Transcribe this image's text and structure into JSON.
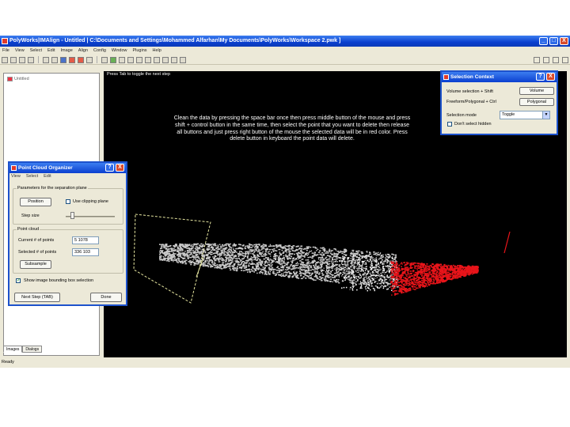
{
  "window": {
    "title": "PolyWorks|IMAlign - Untitled | C:\\Documents and Settings\\Mohammed Alfarhan\\My Documents\\PolyWorks\\Workspace 2.pwk ]",
    "minimize": "_",
    "maximize": "□",
    "close": "X"
  },
  "menu": [
    "File",
    "View",
    "Select",
    "Edit",
    "Image",
    "Align",
    "Config",
    "Window",
    "Plugins",
    "Help"
  ],
  "tree": {
    "item": "Untitled"
  },
  "tabs": [
    "Images",
    "Dialogs"
  ],
  "viewport": {
    "label": "Press Tab to toggle the next step",
    "instructions": "Clean the data by pressing the space bar once then press middle button of the mouse and press shift + control button in the same time, then select the point that you want to delete then release all buttons and just press right button of the mouse the selected data will be in red color. Press delete button in keyboard the point data will delete."
  },
  "status": "Ready",
  "selection_context": {
    "title": "Selection Context",
    "volume_label": "Volume selection + Shift",
    "volume_button": "Volume",
    "freeform_label": "Freeform/Polygonal + Ctrl",
    "freeform_button": "Polygonal",
    "mode_label": "Selection mode",
    "mode_value": "Toggle",
    "dont_select_label": "Don't select hidden"
  },
  "point_cloud_organizer": {
    "title": "Point Cloud Organizer",
    "menu": [
      "View",
      "Select",
      "Edit"
    ],
    "group1_title": "Parameters for the separation plane",
    "position_button": "Position",
    "use_clipping_label": "Use clipping plane",
    "step_label": "Step size",
    "group2_title": "Point cloud",
    "current_points_label": "Current # of points",
    "current_points_value": "5 1078",
    "selected_points_label": "Selected # of points",
    "selected_points_value": "336 103",
    "subsample_button": "Subsample",
    "show_image_label": "Show image bounding box selection",
    "next_step_button": "Next Step (TAB)",
    "done_button": "Done"
  },
  "colors": {
    "selected_points": "#e8141a",
    "cloud": "#c9c9c9",
    "bounding_box": "#e6e6a0"
  }
}
